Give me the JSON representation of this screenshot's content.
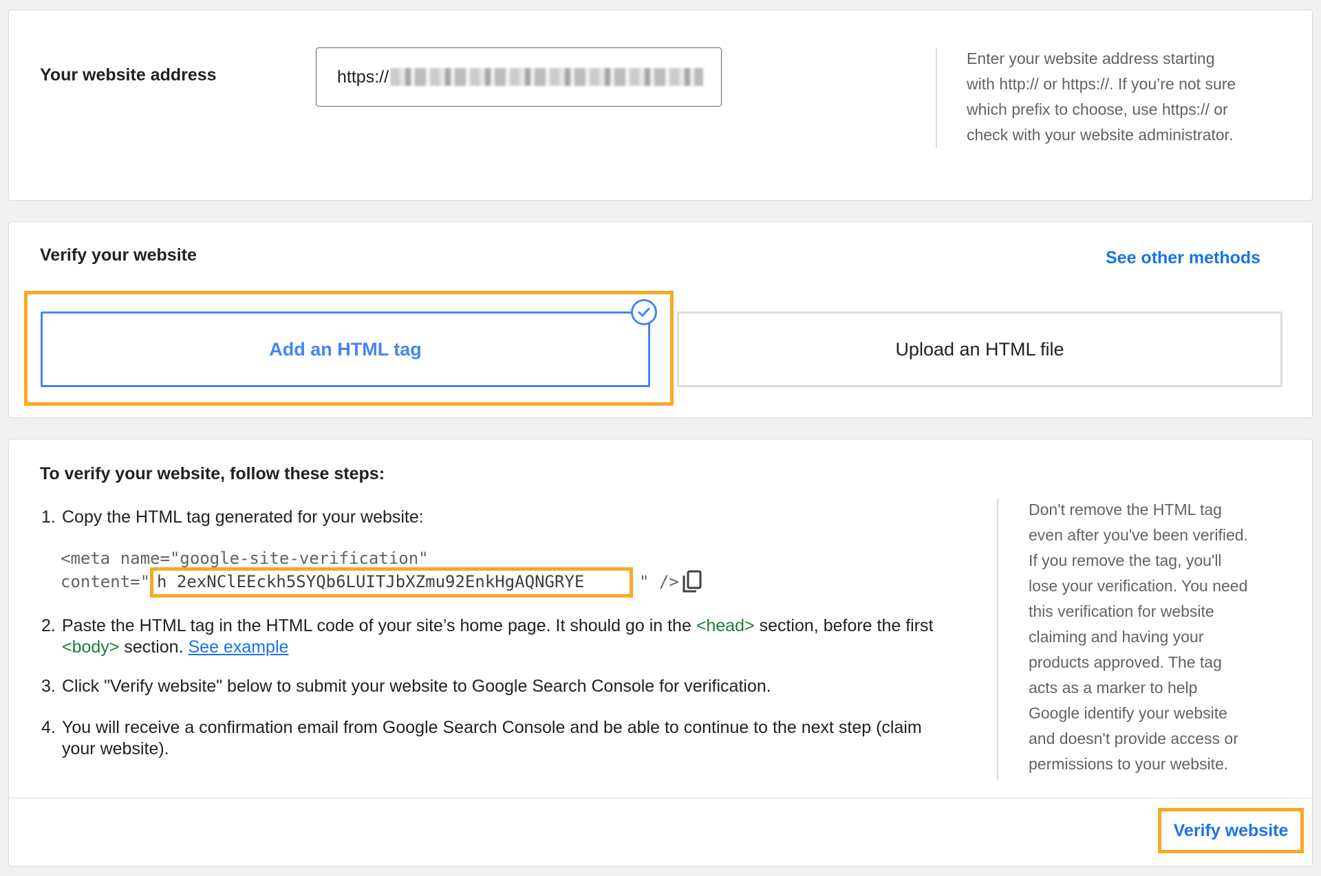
{
  "address": {
    "label": "Your website address",
    "url_prefix": "https://",
    "help_lines": [
      "Enter your website address starting",
      "with http:// or https://. If you’re not sure",
      "which prefix to choose, use https:// or",
      "check with your website administrator."
    ]
  },
  "verify": {
    "title": "Verify your website",
    "other_methods": "See other methods",
    "method_tag_label": "Add an HTML tag",
    "method_file_label": "Upload an HTML file",
    "selected": "Add an HTML tag"
  },
  "steps": {
    "title": "To verify your website, follow these steps:",
    "step1_num": "1.",
    "step1_text": "Copy the HTML tag generated for your website:",
    "code_line1": "<meta name=\"google-site-verification\"",
    "code_line2_prefix": "content=\"",
    "code_token": "h 2exNClEEckh5SYQb6LUITJbXZmu92EnkHgAQNGRYE",
    "code_line2_suffix": "\" />",
    "step2_num": "2.",
    "step2_part1": "Paste the HTML tag in the HTML code of your site’s home page. It should go in the ",
    "step2_head": "<head>",
    "step2_part2": " section, before the first",
    "step2_body": "<body>",
    "step2_part3": " section. ",
    "step2_link": "See example",
    "step3_num": "3.",
    "step3_text": "Click \"Verify website\" below to submit your website to Google Search Console for verification.",
    "step4_num": "4.",
    "step4_line1": "You will receive a confirmation email from Google Search Console and be able to continue to the next step (claim",
    "step4_line2": "your website).",
    "side_note_lines": [
      "Don't remove the HTML tag",
      "even after you've been verified.",
      "If you remove the tag, you'll",
      "lose your verification. You need",
      "this verification for website",
      "claiming and having your",
      "products approved. The tag",
      "acts as a marker to help",
      "Google identify your website",
      "and doesn't provide access or",
      "permissions to your website."
    ],
    "verify_button": "Verify website"
  },
  "icons": {
    "copy": "copy-icon",
    "check": "check-circle-icon"
  },
  "colors": {
    "accent_blue": "#1a73e8",
    "highlight_orange": "#f9a824",
    "tag_green": "#188038"
  }
}
